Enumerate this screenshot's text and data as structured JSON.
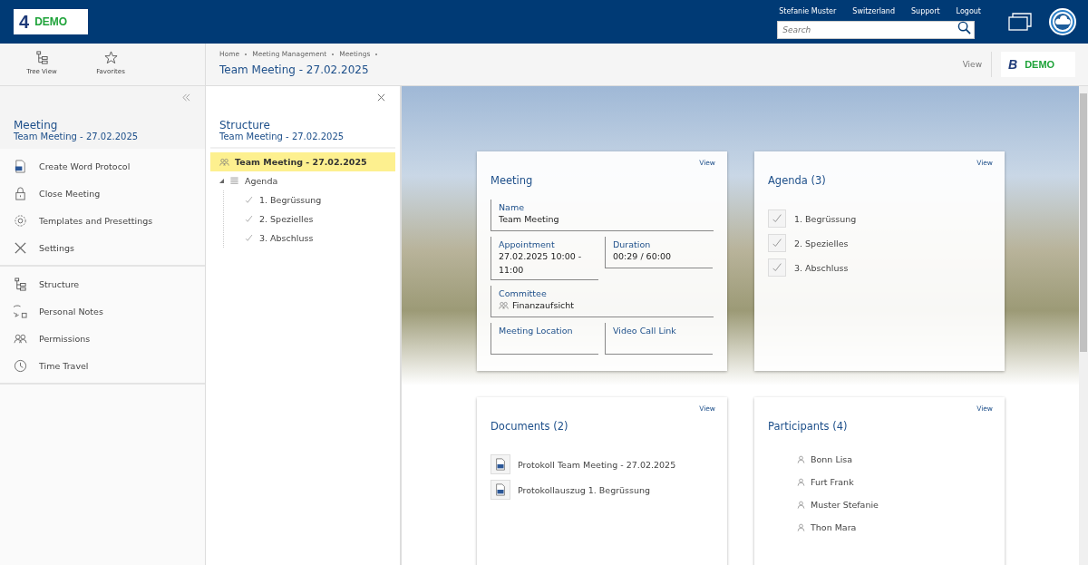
{
  "header": {
    "logo_mark": "4",
    "logo_text": "DEMO",
    "links": [
      "Stefanie Muster",
      "Switzerland",
      "Support",
      "Logout"
    ],
    "search": {
      "placeholder": "Search"
    }
  },
  "toolbar": [
    {
      "label": "Tree View"
    },
    {
      "label": "Favorites"
    }
  ],
  "breadcrumb": [
    "Home",
    "Meeting Management",
    "Meetings"
  ],
  "page_title": "Team Meeting - 27.02.2025",
  "view_label": "View",
  "brand": {
    "mark": "B",
    "text": "DEMO"
  },
  "sidebar": {
    "title": "Meeting",
    "subtitle": "Team Meeting - 27.02.2025",
    "groups": [
      [
        {
          "label": "Create Word Protocol"
        },
        {
          "label": "Close Meeting"
        },
        {
          "label": "Templates and Presettings"
        },
        {
          "label": "Settings"
        }
      ],
      [
        {
          "label": "Structure"
        },
        {
          "label": "Personal Notes"
        },
        {
          "label": "Permissions"
        },
        {
          "label": "Time Travel"
        }
      ]
    ]
  },
  "structure": {
    "title": "Structure",
    "subtitle": "Team Meeting - 27.02.2025",
    "tree": [
      {
        "label": "Team Meeting - 27.02.2025",
        "selected": true
      },
      {
        "label": "Agenda",
        "selected": false,
        "children": [
          {
            "label": "1. Begrüssung",
            "selected": false
          },
          {
            "label": "2. Spezielles",
            "selected": false
          },
          {
            "label": "3. Abschluss",
            "selected": false
          }
        ]
      }
    ]
  },
  "cards": [
    {
      "kind": "fields",
      "title": "Meeting",
      "action": "View",
      "rows": [
        [
          {
            "label": "Name",
            "value": "Team Meeting"
          }
        ],
        [
          {
            "label": "Appointment",
            "value": "27.02.2025 10:00 - 11:00"
          },
          {
            "label": "Duration",
            "value": "00:29 / 60:00"
          }
        ],
        [
          {
            "label": "Committee",
            "value": "Finanzaufsicht"
          }
        ],
        [
          {
            "label": "Meeting Location"
          },
          {
            "label": "Video Call Link"
          }
        ]
      ]
    },
    {
      "kind": "checklist",
      "title": "Agenda (3)",
      "action": "View",
      "items": [
        {
          "label": "1. Begrüssung",
          "checked": true
        },
        {
          "label": "2. Spezielles",
          "checked": true
        },
        {
          "label": "3. Abschluss",
          "checked": true
        }
      ]
    },
    {
      "kind": "documents",
      "title": "Documents (2)",
      "action": "View",
      "items": [
        "Protokoll Team Meeting - 27.02.2025",
        "Protokollauszug 1. Begrüssung"
      ]
    },
    {
      "kind": "people",
      "title": "Participants (4)",
      "action": "View",
      "items": [
        "Bonn Lisa",
        "Furt Frank",
        "Muster Stefanie",
        "Thon Mara"
      ]
    }
  ]
}
